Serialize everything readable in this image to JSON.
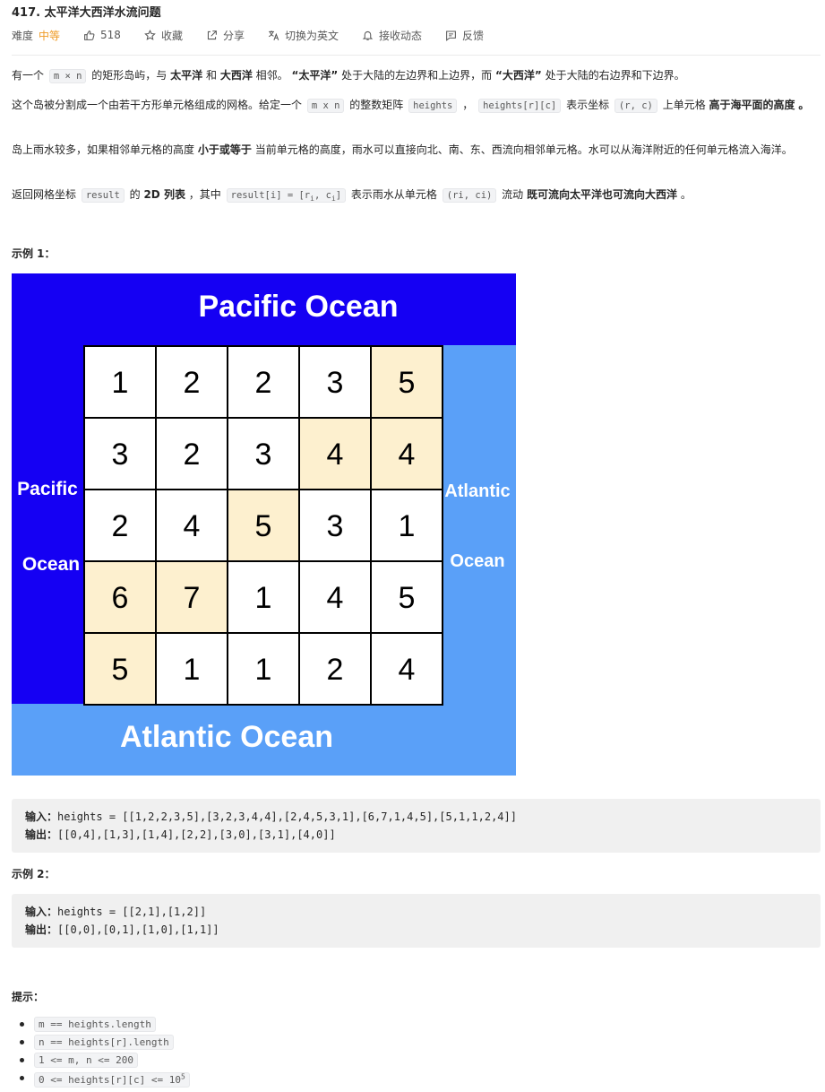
{
  "problem": {
    "title": "417. 太平洋大西洋水流问题",
    "difficulty_label": "难度",
    "difficulty": "中等",
    "likes": "518",
    "actions": {
      "favorite": "收藏",
      "share": "分享",
      "switch_lang": "切换为英文",
      "subscribe": "接收动态",
      "feedback": "反馈"
    }
  },
  "description": {
    "p1": {
      "t1": "有一个",
      "c1": "m × n",
      "t2": "的矩形岛屿，与",
      "b1": "太平洋",
      "t3": "和",
      "b2": "大西洋",
      "t4": "相邻。",
      "b3": "“太平洋”",
      "t5": "处于大陆的左边界和上边界，而",
      "b4": "“大西洋”",
      "t6": "处于大陆的右边界和下边界。"
    },
    "p2": {
      "t1": "这个岛被分割成一个由若干方形单元格组成的网格。给定一个",
      "c1": "m x n",
      "t2": "的整数矩阵",
      "c2": "heights",
      "t3": "，",
      "c3": "heights[r][c]",
      "t4": "表示坐标",
      "c4": "(r, c)",
      "t5": "上单元格",
      "b1": "高于海平面的高度",
      "t6": "。"
    },
    "p3": {
      "t1": "岛上雨水较多，如果相邻单元格的高度",
      "b1": "小于或等于",
      "t2": "当前单元格的高度，雨水可以直接向北、南、东、西流向相邻单元格。水可以从海洋附近的任何单元格流入海洋。"
    },
    "p4": {
      "t1": "返回网格坐标",
      "c1": "result",
      "t2": "的",
      "b1": "2D 列表",
      "t3": "，其中",
      "c2a": "result[i] = [r",
      "c2s1": "i",
      "c2b": ", c",
      "c2s2": "i",
      "c2c": "]",
      "t4": "表示雨水从单元格",
      "c3": "(ri, ci)",
      "t5": "流动",
      "b2": "既可流向太平洋也可流向大西洋",
      "t6": "。"
    }
  },
  "example1": {
    "heading": "示例 1：",
    "input_label": "输入：",
    "input": "heights = [[1,2,2,3,5],[3,2,3,4,4],[2,4,5,3,1],[6,7,1,4,5],[5,1,1,2,4]]",
    "output_label": "输出：",
    "output": "[[0,4],[1,3],[1,4],[2,2],[3,0],[3,1],[4,0]]"
  },
  "example2": {
    "heading": "示例 2：",
    "input_label": "输入：",
    "input": "heights = [[2,1],[1,2]]",
    "output_label": "输出：",
    "output": "[[0,0],[0,1],[1,0],[1,1]]"
  },
  "diagram": {
    "pacific_top": "Pacific Ocean",
    "pacific_left_1": "Pacific",
    "pacific_left_2": "Ocean",
    "atlantic_right_1": "Atlantic",
    "atlantic_right_2": "Ocean",
    "atlantic_bottom": "Atlantic Ocean",
    "grid": [
      [
        1,
        2,
        2,
        3,
        5
      ],
      [
        3,
        2,
        3,
        4,
        4
      ],
      [
        2,
        4,
        5,
        3,
        1
      ],
      [
        6,
        7,
        1,
        4,
        5
      ],
      [
        5,
        1,
        1,
        2,
        4
      ]
    ],
    "highlighted": [
      [
        0,
        4
      ],
      [
        1,
        3
      ],
      [
        1,
        4
      ],
      [
        2,
        2
      ],
      [
        3,
        0
      ],
      [
        3,
        1
      ],
      [
        4,
        0
      ]
    ],
    "colors": {
      "pacific": "#1500f3",
      "atlantic": "#5aa0f8",
      "highlight": "#fdf0cf",
      "cell": "#ffffff"
    }
  },
  "hints": {
    "heading": "提示：",
    "items": [
      {
        "text": "m == heights.length"
      },
      {
        "text": "n == heights[r].length"
      },
      {
        "text": "1 <= m, n <= 200"
      },
      {
        "text_a": "0 <= heights[r][c] <= 10",
        "sup": "5"
      }
    ]
  }
}
